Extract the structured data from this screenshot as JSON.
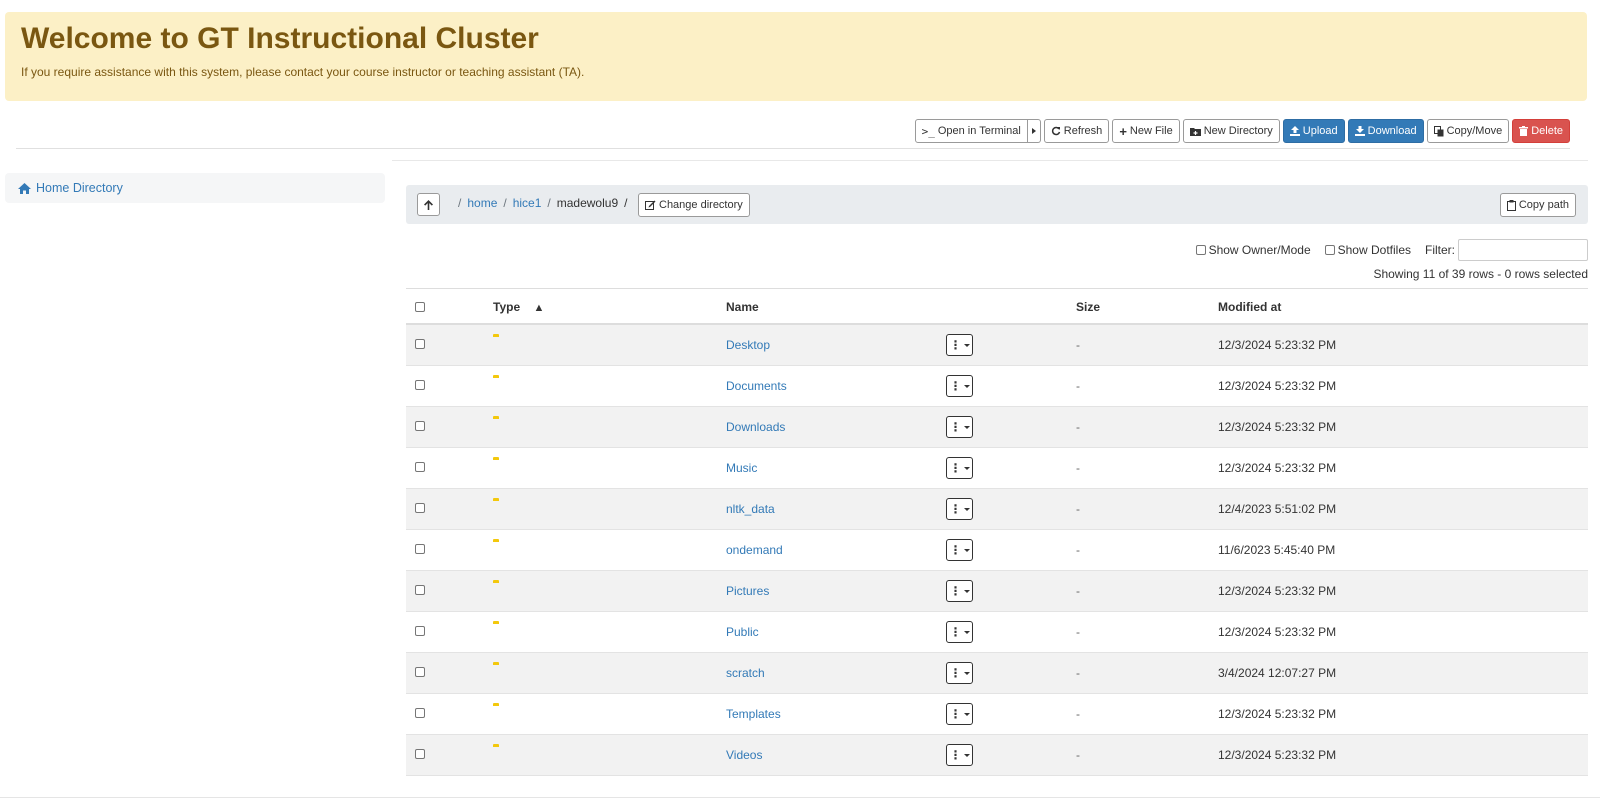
{
  "banner": {
    "title": "Welcome to GT Instructional Cluster",
    "text": "If you require assistance with this system, please contact your course instructor or teaching assistant (TA)."
  },
  "toolbar": {
    "open_terminal": "Open in Terminal",
    "refresh": "Refresh",
    "new_file": "New File",
    "new_directory": "New Directory",
    "upload": "Upload",
    "download": "Download",
    "copy_move": "Copy/Move",
    "delete": "Delete"
  },
  "sidebar": {
    "home_directory": "Home Directory"
  },
  "breadcrumb": {
    "root_sep": "/",
    "parts": [
      "home",
      "hice1"
    ],
    "current": "madewolu9",
    "change_directory": "Change directory",
    "copy_path": "Copy path"
  },
  "options": {
    "show_owner_mode": "Show Owner/Mode",
    "show_dotfiles": "Show Dotfiles",
    "filter_label": "Filter:",
    "filter_value": ""
  },
  "status": {
    "showing": "Showing 11 of 39 rows - 0 rows selected"
  },
  "table": {
    "headers": {
      "type": "Type",
      "name": "Name",
      "size": "Size",
      "modified": "Modified at"
    },
    "sort_indicator": "▲",
    "rows": [
      {
        "name": "Desktop",
        "size": "-",
        "modified": "12/3/2024 5:23:32 PM"
      },
      {
        "name": "Documents",
        "size": "-",
        "modified": "12/3/2024 5:23:32 PM"
      },
      {
        "name": "Downloads",
        "size": "-",
        "modified": "12/3/2024 5:23:32 PM"
      },
      {
        "name": "Music",
        "size": "-",
        "modified": "12/3/2024 5:23:32 PM"
      },
      {
        "name": "nltk_data",
        "size": "-",
        "modified": "12/4/2023 5:51:02 PM"
      },
      {
        "name": "ondemand",
        "size": "-",
        "modified": "11/6/2023 5:45:40 PM"
      },
      {
        "name": "Pictures",
        "size": "-",
        "modified": "12/3/2024 5:23:32 PM"
      },
      {
        "name": "Public",
        "size": "-",
        "modified": "12/3/2024 5:23:32 PM"
      },
      {
        "name": "scratch",
        "size": "-",
        "modified": "3/4/2024 12:07:27 PM"
      },
      {
        "name": "Templates",
        "size": "-",
        "modified": "12/3/2024 5:23:32 PM"
      },
      {
        "name": "Videos",
        "size": "-",
        "modified": "12/3/2024 5:23:32 PM"
      }
    ]
  },
  "colors": {
    "banner_bg": "#fcf0c6",
    "banner_text": "#7a5711",
    "primary": "#337ab7",
    "danger": "#d9534f",
    "folder": "#f3c80c"
  },
  "icons": {
    "terminal": "terminal-icon",
    "refresh": "refresh-icon",
    "new_file": "plus-icon",
    "new_directory": "folder-plus-icon",
    "upload": "upload-icon",
    "download": "download-icon",
    "copy_move": "copy-icon",
    "delete": "trash-icon",
    "home": "home-icon",
    "up": "arrow-up-icon",
    "change_directory": "edit-icon",
    "copy_path": "clipboard-icon",
    "folder": "folder-icon",
    "row_actions": "vertical-ellipsis-icon"
  }
}
